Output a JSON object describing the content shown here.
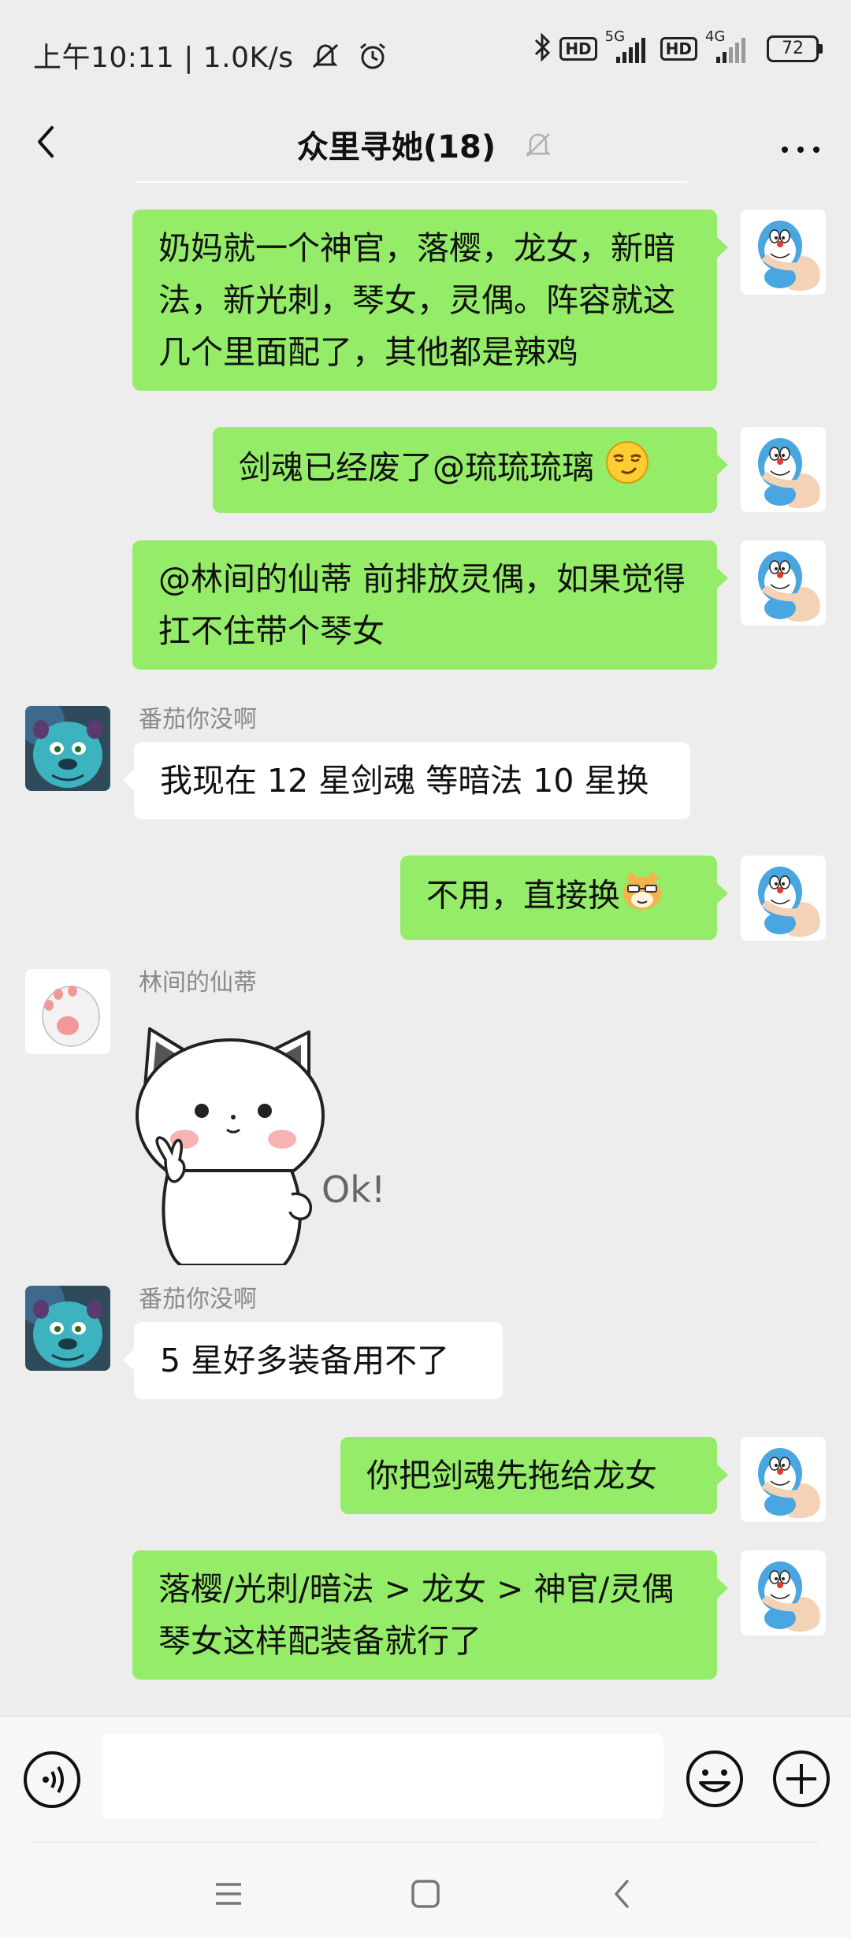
{
  "status_bar": {
    "time": "上午10:11",
    "speed": "1.0K/s",
    "network_1": "5G",
    "network_2": "4G",
    "hd_badge": "HD",
    "battery": "72",
    "icons": [
      "mute-icon",
      "alarm-icon",
      "bluetooth-icon",
      "signal-icon",
      "battery-icon"
    ]
  },
  "header": {
    "title": "众里寻她(18)",
    "icons": [
      "back-icon",
      "muted-bell-icon",
      "more-icon"
    ]
  },
  "messages": [
    {
      "side": "me",
      "text": "奶妈就一个神官，落樱，龙女，新暗法，新光刺，琴女，灵偶。阵容就这几个里面配了，其他都是辣鸡"
    },
    {
      "side": "me",
      "text": "剑魂已经废了@琉琉琉璃 ",
      "emoji": "smirk-emoji"
    },
    {
      "side": "me",
      "text": "@林间的仙蒂  前排放灵偶，如果觉得扛不住带个琴女"
    },
    {
      "side": "them",
      "sender": "番茄你没啊",
      "text": "我现在 12 星剑魂 等暗法 10 星换"
    },
    {
      "side": "me",
      "text": "不用，直接换",
      "emoji": "cat-emoji"
    },
    {
      "side": "them",
      "sender": "林间的仙蒂",
      "sticker_text": "Ok!"
    },
    {
      "side": "them",
      "sender": "番茄你没啊",
      "text": "5 星好多装备用不了"
    },
    {
      "side": "me",
      "text": "你把剑魂先拖给龙女"
    },
    {
      "side": "me",
      "text": "落樱/光刺/暗法 > 龙女 > 神官/灵偶琴女这样配装备就行了"
    }
  ],
  "input_bar": {
    "value": "",
    "icons": [
      "voice-icon",
      "emoji-icon",
      "plus-icon"
    ]
  },
  "system_nav": {
    "icons": [
      "menu-icon",
      "home-icon",
      "back-nav-icon"
    ]
  },
  "colors": {
    "background": "#ededed",
    "my_bubble": "#95ec69",
    "their_bubble": "#ffffff",
    "sender_name": "#8a8a8a"
  }
}
